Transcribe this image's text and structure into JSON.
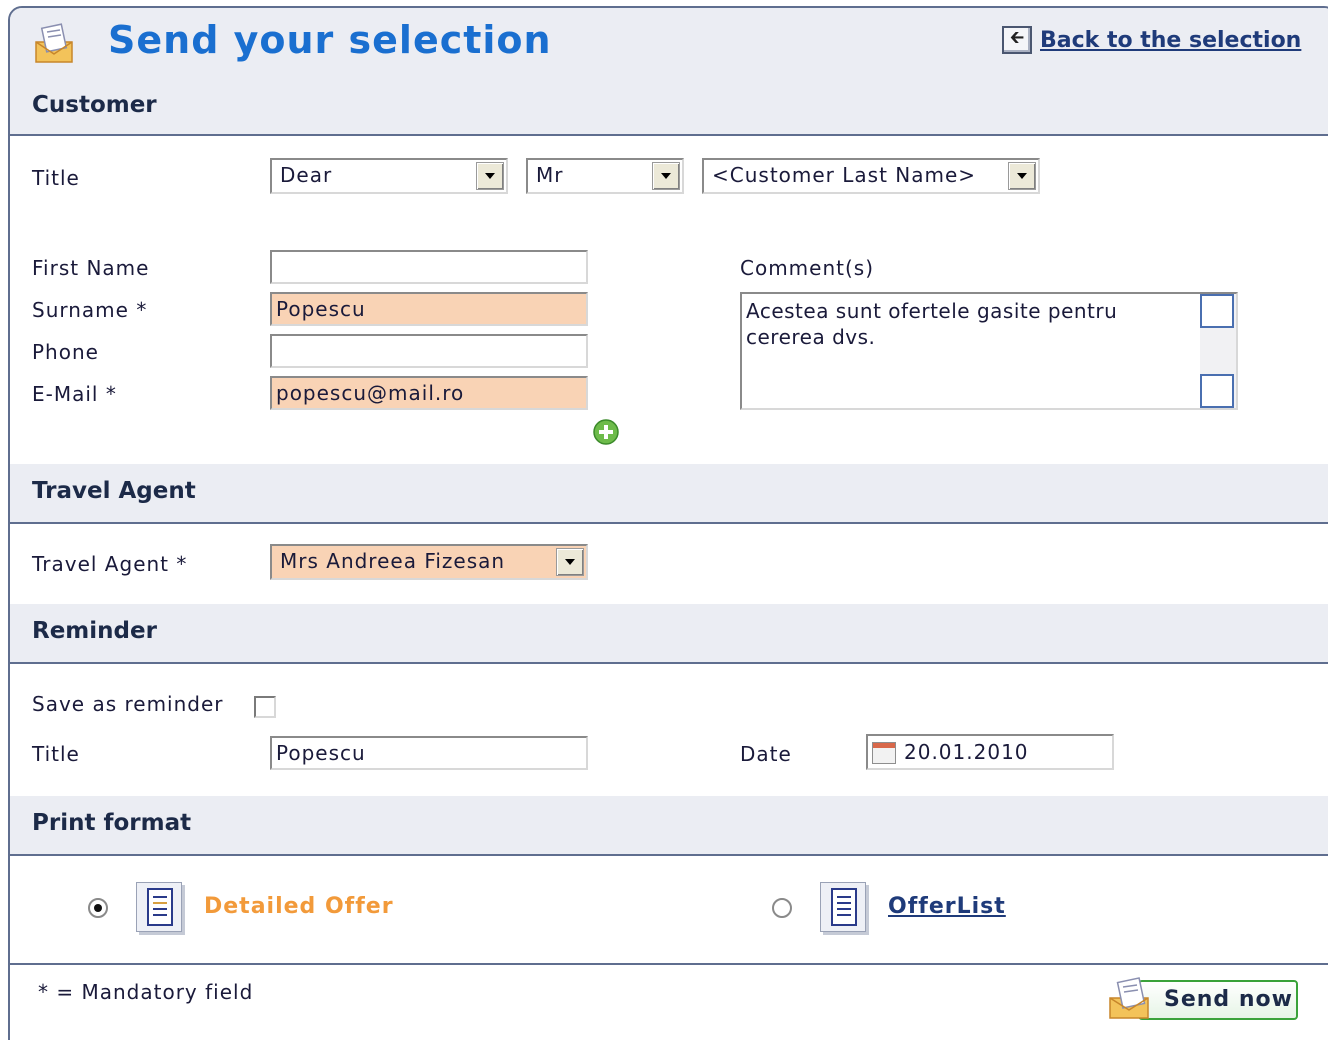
{
  "header": {
    "title": "Send your selection",
    "back_label": "Back to the selection",
    "title_icon": "envelope-letter-icon",
    "back_icon": "arrow-left-icon"
  },
  "customer": {
    "section_title": "Customer",
    "title_label": "Title",
    "salutation": "Dear",
    "honorific": "Mr",
    "name_placeholder": "<Customer Last Name>",
    "first_name_label": "First Name",
    "first_name_value": "",
    "surname_label": "Surname *",
    "surname_value": "Popescu",
    "phone_label": "Phone",
    "phone_value": "",
    "email_label": "E-Mail *",
    "email_value": "popescu@mail.ro",
    "comments_label": "Comment(s)",
    "comments_value": "Acestea sunt ofertele gasite pentru cererea dvs.",
    "add_icon": "plus-circle-icon"
  },
  "travel_agent": {
    "section_title": "Travel Agent",
    "label": "Travel Agent *",
    "value": "Mrs Andreea Fizesan"
  },
  "reminder": {
    "section_title": "Reminder",
    "save_label": "Save as reminder",
    "save_checked": false,
    "title_label": "Title",
    "title_value": "Popescu",
    "date_label": "Date",
    "date_value": "20.01.2010"
  },
  "print_format": {
    "section_title": "Print format",
    "options": [
      {
        "label": "Detailed Offer",
        "selected": true,
        "icon": "document-icon"
      },
      {
        "label": "OfferList",
        "selected": false,
        "icon": "document-list-icon"
      }
    ]
  },
  "footer": {
    "mandatory_note": "* = Mandatory field",
    "send_label": "Send now",
    "send_icon": "envelope-letter-icon"
  },
  "colors": {
    "title_blue": "#1a6fd0",
    "section_bg": "#ebedf3",
    "required_bg": "#f9d3b5",
    "active_orange": "#f29a3a",
    "send_border": "#3aa23a"
  }
}
